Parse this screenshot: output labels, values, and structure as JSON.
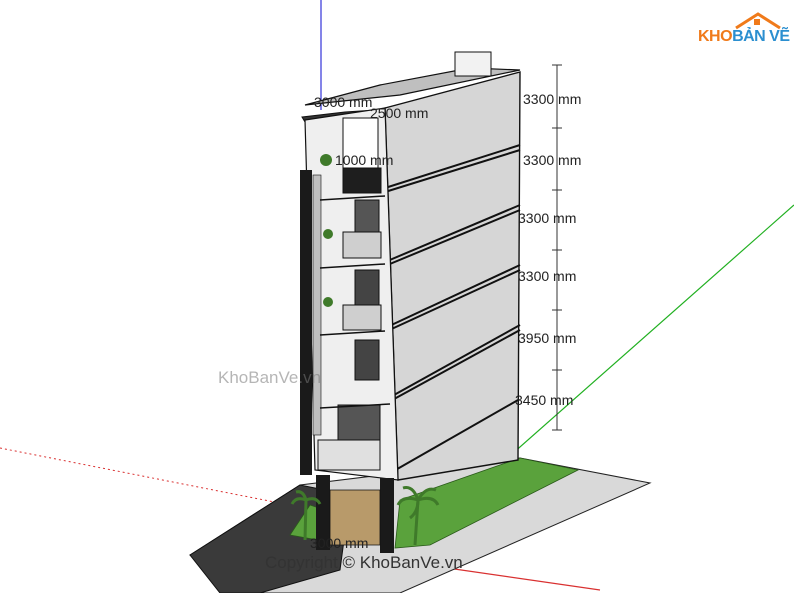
{
  "dimensions": {
    "floors": [
      "3300 mm",
      "3300 mm",
      "3300 mm",
      "3300 mm",
      "3950 mm",
      "3450 mm"
    ],
    "roof_left": "3000 mm",
    "roof_mid": "2500 mm",
    "balcony": "1000 mm",
    "base": "3000 mm"
  },
  "watermark": "KhoBanVe.vn",
  "copyright": "Copyright © KhoBanVe.vn",
  "logo": {
    "part1": "KHO",
    "part2": "BẢN VẼ"
  },
  "colors": {
    "ground_gray": "#d9d9d9",
    "lawn": "#5aa23c",
    "road": "#3a3a3a",
    "axis_green": "#21b021",
    "axis_red": "#d93030",
    "axis_blue": "#3232d8",
    "logo_orange": "#f07a1a",
    "logo_blue": "#2b8fd0"
  }
}
